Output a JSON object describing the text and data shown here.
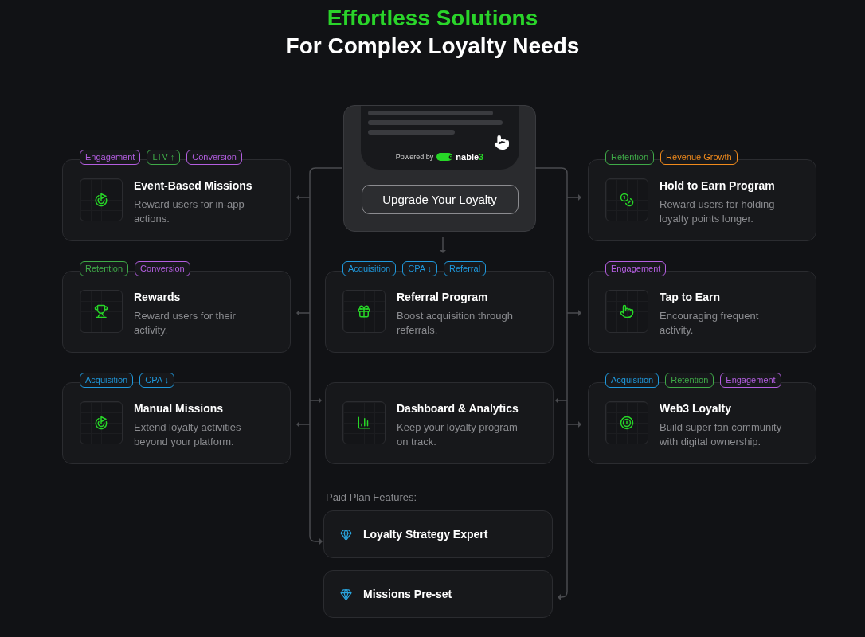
{
  "heading": {
    "line_1": "Effortless Solutions",
    "line_2": "For Complex Loyalty Needs"
  },
  "upgrade_panel": {
    "powered_by": "Powered by",
    "brand": {
      "toggle_letter": "e",
      "name": "nable",
      "suffix": "3"
    },
    "button": "Upgrade Your Loyalty"
  },
  "left_column": [
    {
      "title": "Event-Based Missions",
      "description": "Reward users for in-app actions.",
      "tags": [
        {
          "label": "Engagement",
          "color": "#b35ee0"
        },
        {
          "label": "LTV ↑",
          "color": "#3faa48"
        },
        {
          "label": "Conversion",
          "color": "#b35ee0"
        }
      ]
    },
    {
      "title": "Rewards",
      "description": "Reward users for their activity.",
      "tags": [
        {
          "label": "Retention",
          "color": "#3faa48"
        },
        {
          "label": "Conversion",
          "color": "#b35ee0"
        }
      ]
    },
    {
      "title": "Manual Missions",
      "description": "Extend loyalty activities beyond your platform.",
      "tags": [
        {
          "label": "Acquisition",
          "color": "#1f98dc"
        },
        {
          "label": "CPA ↓",
          "color": "#1f98dc"
        }
      ]
    }
  ],
  "center_column": [
    {
      "title": "Referral Program",
      "description": "Boost acquisition through referrals.",
      "tags": [
        {
          "label": "Acquisition",
          "color": "#1f98dc"
        },
        {
          "label": "CPA ↓",
          "color": "#1f98dc"
        },
        {
          "label": "Referral",
          "color": "#1f98dc"
        }
      ]
    },
    {
      "title": "Dashboard & Analytics",
      "description": "Keep your loyalty program on track."
    }
  ],
  "right_column": [
    {
      "title": "Hold to Earn Program",
      "description": "Reward users for holding loyalty points longer.",
      "tags": [
        {
          "label": "Retention",
          "color": "#3faa48"
        },
        {
          "label": "Revenue Growth",
          "color": "#f08a1c"
        }
      ]
    },
    {
      "title": "Tap to Earn",
      "description": "Encouraging frequent activity.",
      "tags": [
        {
          "label": "Engagement",
          "color": "#b35ee0"
        }
      ]
    },
    {
      "title": "Web3 Loyalty",
      "description": "Build super fan community with digital ownership.",
      "tags": [
        {
          "label": "Acquisition",
          "color": "#1f98dc"
        },
        {
          "label": "Retention",
          "color": "#3faa48"
        },
        {
          "label": "Engagement",
          "color": "#b35ee0"
        }
      ]
    }
  ],
  "paid_plan": {
    "label": "Paid Plan Features:",
    "features": [
      "Loyalty Strategy Expert",
      "Missions Pre-set"
    ]
  }
}
